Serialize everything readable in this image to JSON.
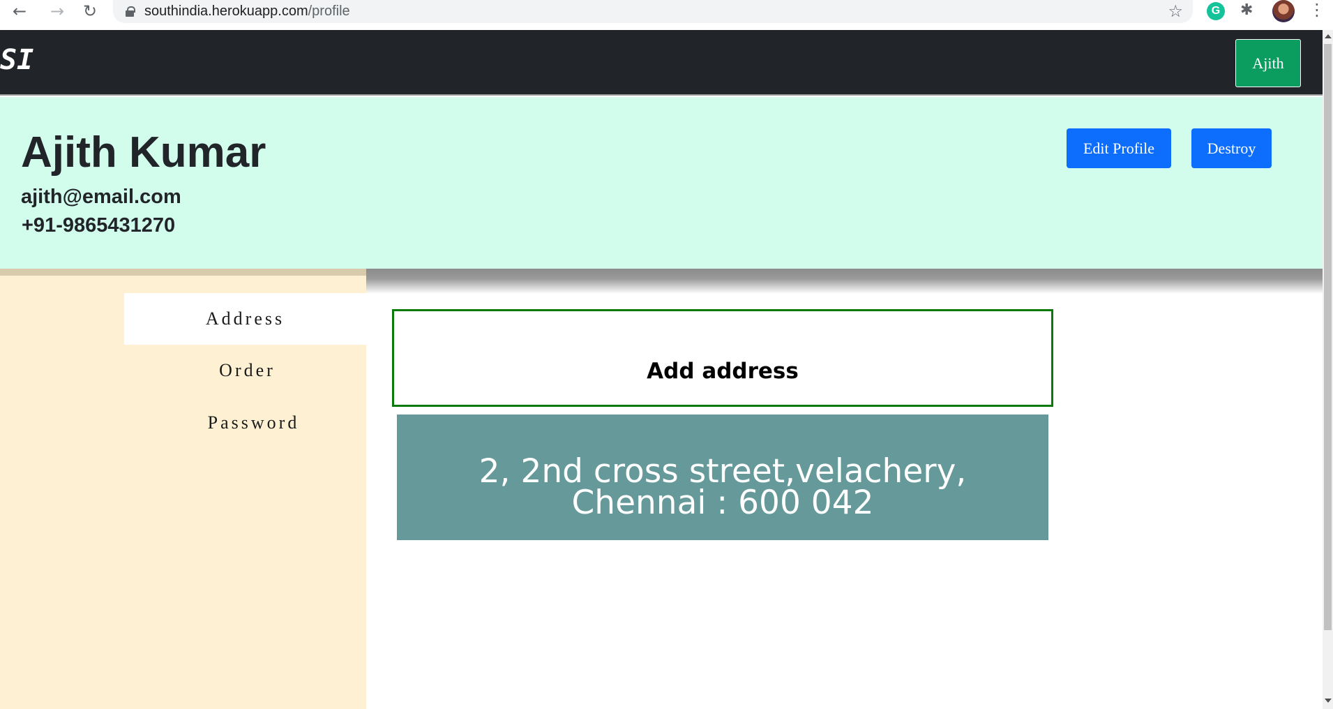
{
  "browser": {
    "back_icon": "←",
    "forward_icon": "→",
    "reload_icon": "↻",
    "url_host": "southindia.herokuapp.com",
    "url_path": "/profile",
    "bookmark_icon": "☆",
    "extension_g": "G",
    "extensions_icon": "✱",
    "menu_icon": "⋮"
  },
  "navbar": {
    "brand": "SI",
    "user_button": "Ajith"
  },
  "profile": {
    "name": "Ajith Kumar",
    "email": "ajith@email.com",
    "phone": "+91-9865431270",
    "edit_button": "Edit Profile",
    "destroy_button": "Destroy"
  },
  "sidebar": {
    "items": [
      {
        "label": "Address",
        "active": true
      },
      {
        "label": "Order",
        "active": false
      },
      {
        "label": "Password",
        "active": false
      }
    ]
  },
  "main": {
    "add_address_label": "Add address",
    "addresses": [
      {
        "text": "2, 2nd cross street,velachery, Chennai : 600 042"
      }
    ]
  },
  "colors": {
    "navbar_bg": "#212529",
    "hero_bg": "#d2fcec",
    "sidebar_bg": "#fdf0d3",
    "user_button_bg": "#0b9c60",
    "primary_button_bg": "#0d6efd",
    "address_card_bg": "#669999",
    "add_box_border": "#0a7a0a"
  }
}
